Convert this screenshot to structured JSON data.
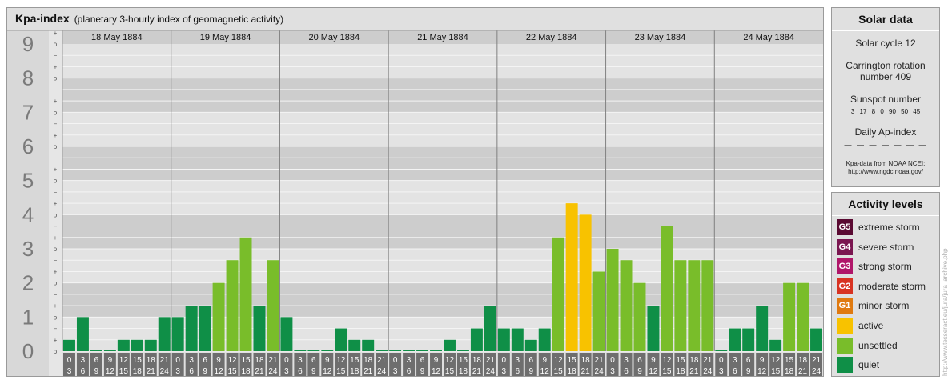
{
  "title": "Kpa-index",
  "subtitle": "(planetary 3-hourly index of geomagnetic activity)",
  "chart_data": {
    "type": "bar",
    "title": "Kpa-index",
    "subtitle": "(planetary 3-hourly index of geomagnetic activity)",
    "ylim": [
      0,
      9
    ],
    "y_ticks": [
      "0",
      "1",
      "2",
      "3",
      "4",
      "5",
      "6",
      "7",
      "8",
      "9"
    ],
    "sub_ticks": [
      "+",
      "o",
      "−"
    ],
    "days": [
      "18 May 1884",
      "19 May 1884",
      "20 May 1884",
      "21 May 1884",
      "22 May 1884",
      "23 May 1884",
      "24 May 1884"
    ],
    "interval_labels": [
      [
        "0",
        "3"
      ],
      [
        "3",
        "6"
      ],
      [
        "6",
        "9"
      ],
      [
        "9",
        "12"
      ],
      [
        "12",
        "15"
      ],
      [
        "15",
        "18"
      ],
      [
        "18",
        "21"
      ],
      [
        "21",
        "24"
      ]
    ],
    "values": [
      [
        0.333,
        1.0,
        0.0,
        0.0,
        0.333,
        0.333,
        0.333,
        1.0
      ],
      [
        1.0,
        1.333,
        1.333,
        2.0,
        2.667,
        3.333,
        1.333,
        2.667
      ],
      [
        1.0,
        0.0,
        0.0,
        0.0,
        0.667,
        0.333,
        0.333,
        0.0
      ],
      [
        0.0,
        0.0,
        0.0,
        0.0,
        0.333,
        0.0,
        0.667,
        1.333
      ],
      [
        0.667,
        0.667,
        0.333,
        0.667,
        3.333,
        4.333,
        4.0,
        2.333
      ],
      [
        3.0,
        2.667,
        2.0,
        1.333,
        3.667,
        2.667,
        2.667,
        2.667
      ],
      [
        0.0,
        0.667,
        0.667,
        1.333,
        0.333,
        2.0,
        2.0,
        0.667
      ]
    ],
    "grid": true,
    "colors": {
      "quiet": "#0f8f47",
      "unsettled": "#79bd2a",
      "active": "#f8c200"
    }
  },
  "solar": {
    "heading": "Solar data",
    "cycle": "Solar cycle 12",
    "carrington_line1": "Carrington rotation",
    "carrington_line2": "number 409",
    "sunspot_label": "Sunspot number",
    "sunspot_values": "3 17 8 0 90 50 45",
    "ap_label": "Daily Ap-index",
    "ap_values": "— — — — — — —",
    "source_line1": "Kpa-data from NOAA NCEI:",
    "source_line2": "http://www.ngdc.noaa.gov/"
  },
  "levels": {
    "heading": "Activity levels",
    "items": [
      {
        "code": "G5",
        "label": "extreme storm",
        "color": "#5a0a32"
      },
      {
        "code": "G4",
        "label": "severe storm",
        "color": "#7a1650"
      },
      {
        "code": "G3",
        "label": "strong storm",
        "color": "#b01669"
      },
      {
        "code": "G2",
        "label": "moderate storm",
        "color": "#d83322"
      },
      {
        "code": "G1",
        "label": "minor storm",
        "color": "#e07a10"
      },
      {
        "code": "",
        "label": "active",
        "color": "#f8c200"
      },
      {
        "code": "",
        "label": "unsettled",
        "color": "#79bd2a"
      },
      {
        "code": "",
        "label": "quiet",
        "color": "#0f8f47"
      }
    ]
  },
  "watermark": "http://www.tesseract.eu/jura/jura_archive.php"
}
